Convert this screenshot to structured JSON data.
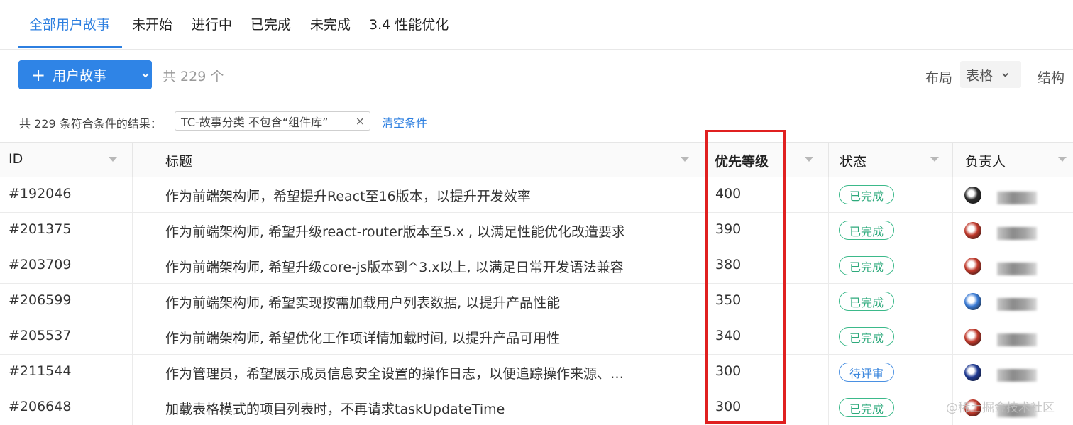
{
  "tabs": [
    {
      "label": "全部用户故事",
      "active": true
    },
    {
      "label": "未开始",
      "active": false
    },
    {
      "label": "进行中",
      "active": false
    },
    {
      "label": "已完成",
      "active": false
    },
    {
      "label": "未完成",
      "active": false
    },
    {
      "label": "3.4 性能优化",
      "active": false
    }
  ],
  "toolbar": {
    "add_label": "用户故事",
    "count_text": "共 229 个",
    "layout_label": "布局",
    "layout_value": "表格",
    "structure_label": "结构"
  },
  "filter": {
    "result_text": "共 229 条符合条件的结果：",
    "tag_text": "TC-故事分类 不包含“组件库”",
    "tag_close": "×",
    "clear_label": "清空条件"
  },
  "table": {
    "columns": [
      "ID",
      "标题",
      "优先等级",
      "状态",
      "负责人"
    ],
    "rows": [
      {
        "id": "#192046",
        "title": "作为前端架构师，希望提升React至16版本，以提升开发效率",
        "priority": "400",
        "status": "已完成",
        "avatar_color": "#2b2b2b"
      },
      {
        "id": "#201375",
        "title": "作为前端架构师, 希望升级react-router版本至5.x , 以满足性能优化改造要求",
        "priority": "390",
        "status": "已完成",
        "avatar_color": "#c0392b"
      },
      {
        "id": "#203709",
        "title": "作为前端架构师, 希望升级core-js版本到^3.x以上, 以满足日常开发语法兼容",
        "priority": "380",
        "status": "已完成",
        "avatar_color": "#c0392b"
      },
      {
        "id": "#206599",
        "title": "作为前端架构师, 希望实现按需加载用户列表数据, 以提升产品性能",
        "priority": "350",
        "status": "已完成",
        "avatar_color": "#3a7bd5"
      },
      {
        "id": "#205537",
        "title": "作为前端架构师, 希望优化工作项详情加载时间, 以提升产品可用性",
        "priority": "340",
        "status": "已完成",
        "avatar_color": "#c0392b"
      },
      {
        "id": "#211544",
        "title": "作为管理员，希望展示成员信息安全设置的操作日志，以便追踪操作来源、…",
        "priority": "300",
        "status": "待评审",
        "avatar_color": "#1f3a93"
      },
      {
        "id": "#206648",
        "title": "加载表格模式的项目列表时，不再请求taskUpdateTime",
        "priority": "300",
        "status": "已完成",
        "avatar_color": "#c0392b"
      }
    ]
  },
  "watermark": "@稀土掘金技术社区",
  "colors": {
    "accent": "#2d7fe0",
    "done": "#2eaa7c",
    "review": "#3a86dd",
    "highlight": "#e02020"
  }
}
